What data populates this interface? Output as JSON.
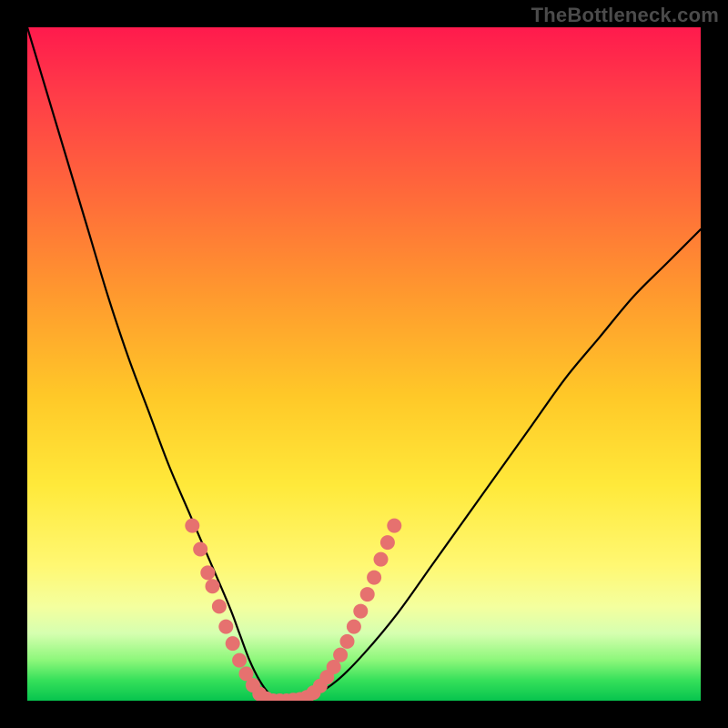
{
  "watermark": "TheBottleneck.com",
  "chart_data": {
    "type": "line",
    "title": "",
    "xlabel": "",
    "ylabel": "",
    "xlim": [
      0,
      100
    ],
    "ylim": [
      0,
      100
    ],
    "grid": false,
    "legend_position": "none",
    "series": [
      {
        "name": "bottleneck-curve",
        "x": [
          0,
          3,
          6,
          9,
          12,
          15,
          18,
          21,
          24,
          27,
          30,
          31.5,
          33,
          34.5,
          36,
          38,
          42,
          46,
          50,
          55,
          60,
          65,
          70,
          75,
          80,
          85,
          90,
          95,
          100
        ],
        "y": [
          100,
          90,
          80,
          70,
          60,
          51,
          43,
          35,
          28,
          21,
          14,
          10,
          6,
          3,
          1,
          0,
          0.5,
          3,
          7,
          13,
          20,
          27,
          34,
          41,
          48,
          54,
          60,
          65,
          70
        ]
      }
    ],
    "highlight_segments": [
      {
        "name": "left-arm-dots",
        "points": [
          {
            "x": 24.5,
            "y": 26
          },
          {
            "x": 25.7,
            "y": 22.5
          },
          {
            "x": 26.8,
            "y": 19
          },
          {
            "x": 27.5,
            "y": 17
          },
          {
            "x": 28.5,
            "y": 14
          },
          {
            "x": 29.5,
            "y": 11
          },
          {
            "x": 30.5,
            "y": 8.5
          },
          {
            "x": 31.5,
            "y": 6
          },
          {
            "x": 32.5,
            "y": 4
          },
          {
            "x": 33.5,
            "y": 2.3
          },
          {
            "x": 34.5,
            "y": 1
          }
        ]
      },
      {
        "name": "bottom-flat-dots",
        "points": [
          {
            "x": 35.5,
            "y": 0.3
          },
          {
            "x": 36.5,
            "y": 0
          },
          {
            "x": 37.5,
            "y": 0
          },
          {
            "x": 38.5,
            "y": 0
          },
          {
            "x": 39.5,
            "y": 0.1
          },
          {
            "x": 40.5,
            "y": 0.2
          }
        ]
      },
      {
        "name": "right-arm-dots",
        "points": [
          {
            "x": 41.5,
            "y": 0.5
          },
          {
            "x": 42.5,
            "y": 1.2
          },
          {
            "x": 43.5,
            "y": 2.2
          },
          {
            "x": 44.5,
            "y": 3.5
          },
          {
            "x": 45.5,
            "y": 5
          },
          {
            "x": 46.5,
            "y": 6.8
          },
          {
            "x": 47.5,
            "y": 8.8
          },
          {
            "x": 48.5,
            "y": 11
          },
          {
            "x": 49.5,
            "y": 13.3
          },
          {
            "x": 50.5,
            "y": 15.8
          },
          {
            "x": 51.5,
            "y": 18.3
          },
          {
            "x": 52.5,
            "y": 21
          },
          {
            "x": 53.5,
            "y": 23.5
          },
          {
            "x": 54.5,
            "y": 26
          }
        ]
      }
    ],
    "colors": {
      "curve": "#000000",
      "dots": "#e6716f",
      "gradient_top": "#ff1a4d",
      "gradient_mid": "#ffe93a",
      "gradient_bottom": "#07c44e",
      "frame": "#000000"
    }
  }
}
